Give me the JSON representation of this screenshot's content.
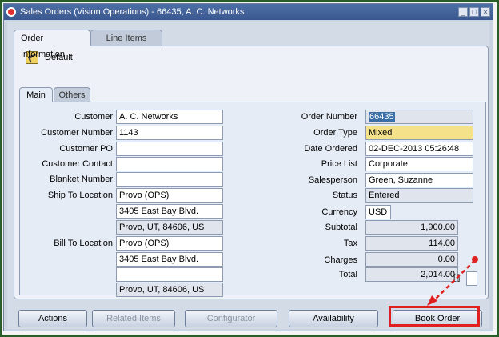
{
  "window": {
    "title": "Sales Orders (Vision Operations) - 66435, A. C. Networks",
    "controls": [
      "_",
      "□",
      "×"
    ]
  },
  "tabs": {
    "order_information": "Order Information",
    "line_items": "Line Items"
  },
  "folder": {
    "label": "Default",
    "icon": "folder-icon"
  },
  "subtabs": {
    "main": "Main",
    "others": "Others"
  },
  "left": {
    "customer_label": "Customer",
    "customer_value": "A. C. Networks",
    "customer_number_label": "Customer Number",
    "customer_number_value": "1143",
    "customer_po_label": "Customer PO",
    "customer_po_value": "",
    "customer_contact_label": "Customer Contact",
    "customer_contact_value": "",
    "blanket_number_label": "Blanket Number",
    "blanket_number_value": "",
    "ship_to_label": "Ship To Location",
    "ship_to_line1": "Provo (OPS)",
    "ship_to_line2": "3405 East Bay Blvd.",
    "ship_to_line3": "Provo, UT, 84606, US",
    "bill_to_label": "Bill To Location",
    "bill_to_line1": "Provo (OPS)",
    "bill_to_line2": "3405 East Bay Blvd.",
    "bill_to_line3": "",
    "bill_to_line4": "Provo, UT, 84606, US"
  },
  "right": {
    "order_number_label": "Order Number",
    "order_number_value": "66435",
    "order_type_label": "Order Type",
    "order_type_value": "Mixed",
    "date_ordered_label": "Date Ordered",
    "date_ordered_value": "02-DEC-2013 05:26:48",
    "price_list_label": "Price List",
    "price_list_value": "Corporate",
    "salesperson_label": "Salesperson",
    "salesperson_value": "Green, Suzanne",
    "status_label": "Status",
    "status_value": "Entered",
    "currency_label": "Currency",
    "currency_value": "USD",
    "subtotal_label": "Subtotal",
    "subtotal_value": "1,900.00",
    "tax_label": "Tax",
    "tax_value": "114.00",
    "charges_label": "Charges",
    "charges_value": "0.00",
    "total_label": "Total",
    "total_value": "2,014.00"
  },
  "small_field_marker": "[ ]",
  "buttons": {
    "actions": "Actions",
    "related_items": "Related Items",
    "configurator": "Configurator",
    "availability": "Availability",
    "book_order": "Book Order"
  },
  "colors": {
    "required_field": "#f5e189",
    "highlight": "#e02020",
    "title_bar": "#3a5890"
  }
}
